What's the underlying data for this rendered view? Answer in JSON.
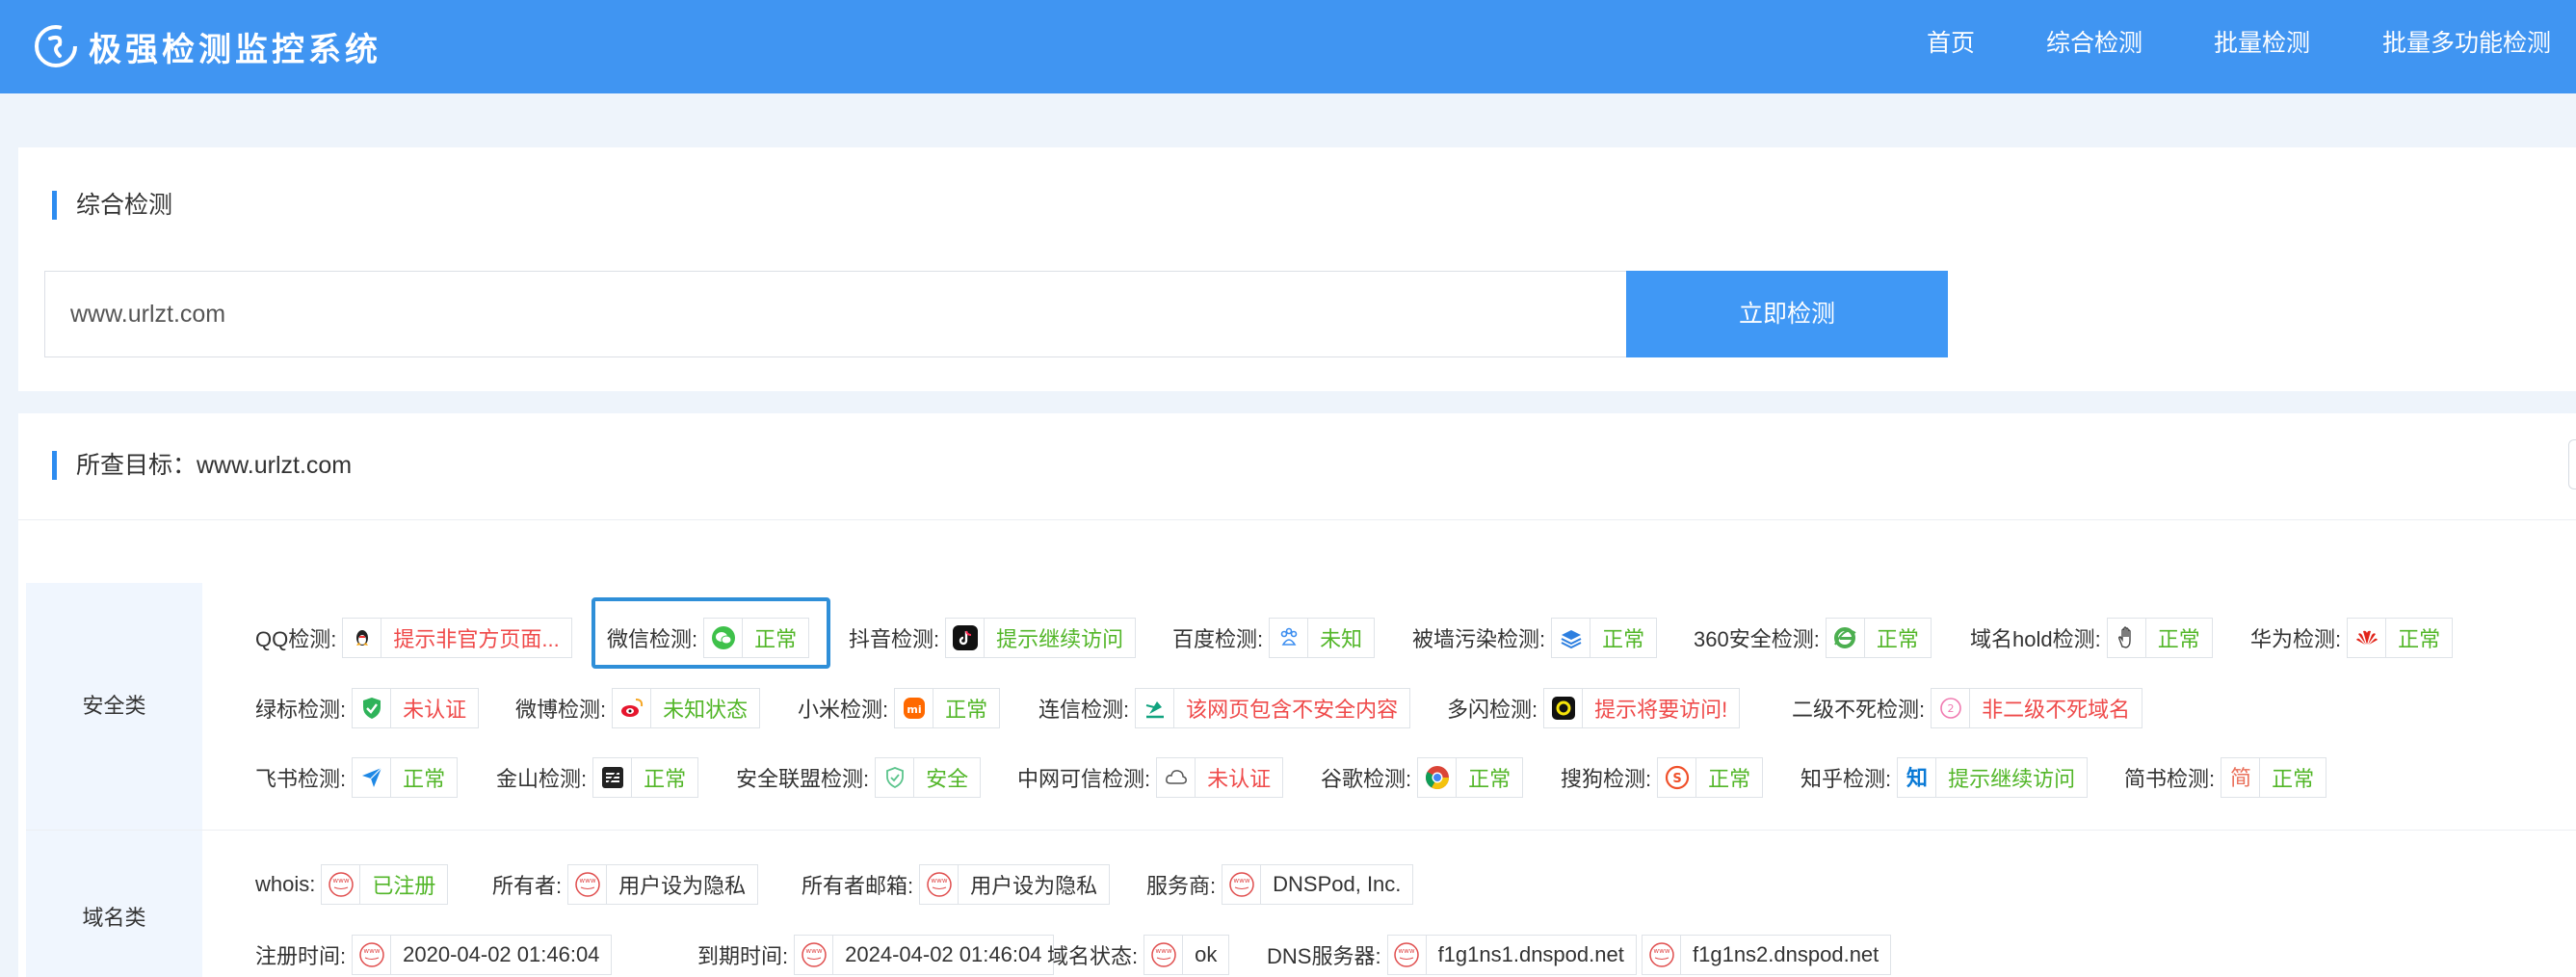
{
  "header": {
    "title": "极强检测监控系统",
    "nav": [
      "首页",
      "综合检测",
      "批量检测",
      "批量多功能检测"
    ]
  },
  "search_panel": {
    "title": "综合检测",
    "input_value": "www.urlzt.com",
    "button": "立即检测"
  },
  "result_panel": {
    "title": "所查目标：www.urlzt.com"
  },
  "security": {
    "label": "安全类",
    "items": [
      {
        "label": "QQ检测:",
        "value": "提示非官方页面...",
        "status": "red",
        "icon": "qq-penguin-icon"
      },
      {
        "label": "微信检测:",
        "value": "正常",
        "status": "green",
        "icon": "wechat-icon"
      },
      {
        "label": "抖音检测:",
        "value": "提示继续访问",
        "status": "green",
        "icon": "douyin-icon"
      },
      {
        "label": "百度检测:",
        "value": "未知",
        "status": "green",
        "icon": "baidu-paw-icon"
      },
      {
        "label": "被墙污染检测:",
        "value": "正常",
        "status": "green",
        "icon": "layers-icon"
      },
      {
        "label": "360安全检测:",
        "value": "正常",
        "status": "green",
        "icon": "ie-360-icon"
      },
      {
        "label": "域名hold检测:",
        "value": "正常",
        "status": "green",
        "icon": "hand-icon"
      },
      {
        "label": "华为检测:",
        "value": "正常",
        "status": "green",
        "icon": "huawei-icon"
      },
      {
        "label": "绿标检测:",
        "value": "未认证",
        "status": "red",
        "icon": "shield-check-icon"
      },
      {
        "label": "微博检测:",
        "value": "未知状态",
        "status": "green",
        "icon": "weibo-icon"
      },
      {
        "label": "小米检测:",
        "value": "正常",
        "status": "green",
        "icon": "xiaomi-icon"
      },
      {
        "label": "连信检测:",
        "value": "该网页包含不安全内容",
        "status": "red",
        "icon": "lianxin-icon"
      },
      {
        "label": "多闪检测:",
        "value": "提示将要访问!",
        "status": "red",
        "icon": "duoshan-icon"
      },
      {
        "label": "二级不死检测:",
        "value": "非二级不死域名",
        "status": "red",
        "icon": "circle-badge-icon"
      },
      {
        "label": "飞书检测:",
        "value": "正常",
        "status": "green",
        "icon": "feishu-icon"
      },
      {
        "label": "金山检测:",
        "value": "正常",
        "status": "green",
        "icon": "kingsoft-icon"
      },
      {
        "label": "安全联盟检测:",
        "value": "安全",
        "status": "green",
        "icon": "anquan-shield-icon"
      },
      {
        "label": "中网可信检测:",
        "value": "未认证",
        "status": "red",
        "icon": "cloud-icon"
      },
      {
        "label": "谷歌检测:",
        "value": "正常",
        "status": "green",
        "icon": "chrome-icon"
      },
      {
        "label": "搜狗检测:",
        "value": "正常",
        "status": "green",
        "icon": "sogou-icon"
      },
      {
        "label": "知乎检测:",
        "value": "提示继续访问",
        "status": "green",
        "icon": "zhihu-icon"
      },
      {
        "label": "简书检测:",
        "value": "正常",
        "status": "green",
        "icon": "jianshu-icon"
      }
    ]
  },
  "domain": {
    "label": "域名类",
    "icon_text": "www",
    "items": [
      {
        "label": "whois:",
        "value": "已注册",
        "status": "green"
      },
      {
        "label": "所有者:",
        "value": "用户设为隐私",
        "status": "dark"
      },
      {
        "label": "所有者邮箱:",
        "value": "用户设为隐私",
        "status": "dark"
      },
      {
        "label": "服务商:",
        "value": "DNSPod, Inc.",
        "status": "dark"
      },
      {
        "label": "注册时间:",
        "value": "2020-04-02 01:46:04",
        "status": "dark"
      },
      {
        "label": "到期时间:",
        "value": "2024-04-02 01:46:04",
        "status": "dark"
      },
      {
        "label": "域名状态:",
        "value": "ok",
        "status": "dark"
      },
      {
        "label": "DNS服务器:",
        "value": "f1g1ns1.dnspod.net",
        "status": "dark"
      },
      {
        "label": "",
        "value": "f1g1ns2.dnspod.net",
        "status": "dark"
      }
    ]
  },
  "colors": {
    "header_bg": "#4095f2",
    "accent": "#2d8cf0",
    "ok_green": "#52b628",
    "warn_red": "#ef4a4a"
  }
}
